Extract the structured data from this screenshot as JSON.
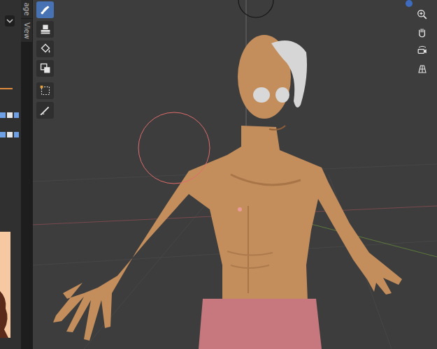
{
  "sidebar_tabs": [
    {
      "label": "age",
      "selected": false
    },
    {
      "label": "View",
      "selected": false
    }
  ],
  "toolbar": [
    [
      {
        "kind": "brush",
        "selected": true
      },
      {
        "kind": "stamp",
        "selected": false
      },
      {
        "kind": "fill",
        "selected": false
      },
      {
        "kind": "clone",
        "selected": false
      }
    ],
    [
      {
        "kind": "select",
        "selected": false
      },
      {
        "kind": "annotate",
        "selected": false
      }
    ]
  ],
  "navigation": [
    {
      "kind": "zoom"
    },
    {
      "kind": "pan"
    },
    {
      "kind": "camera"
    },
    {
      "kind": "grid"
    }
  ]
}
